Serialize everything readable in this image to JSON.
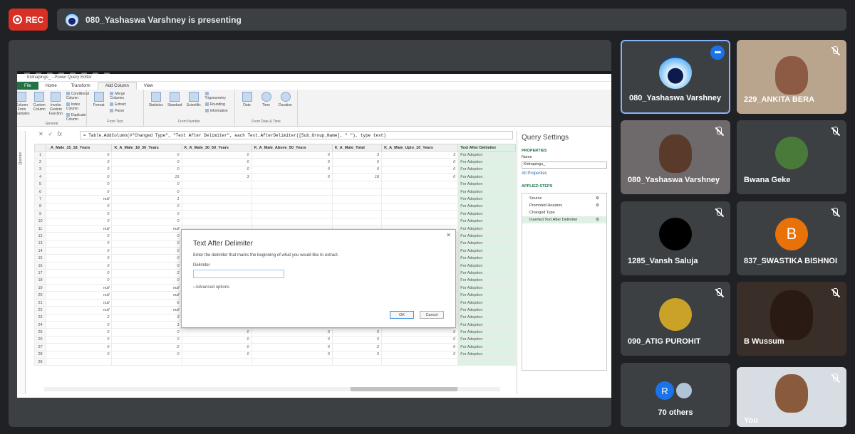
{
  "meet": {
    "rec_label": "REC",
    "presenting_text": "080_Yashaswa Varshney is presenting"
  },
  "app": {
    "window_title": "Kidnapings_ - Power Query Editor",
    "ribbon_tabs": [
      "File",
      "Home",
      "Transform",
      "Add Column",
      "View"
    ],
    "groups": {
      "general": {
        "name": "General",
        "buttons": [
          "Column From Examples",
          "Custom Column",
          "Invoke Custom Function"
        ],
        "list": [
          "Conditional Column",
          "Index Column",
          "Duplicate Column"
        ]
      },
      "from_text": {
        "name": "From Text",
        "buttons": [
          "Format"
        ],
        "list": [
          "Merge Columns",
          "Extract",
          "Parse"
        ]
      },
      "from_number": {
        "name": "From Number",
        "buttons": [
          "Statistics",
          "Standard",
          "Scientific"
        ],
        "list": [
          "Trigonometry",
          "Rounding",
          "Information"
        ]
      },
      "from_date": {
        "name": "From Date & Time",
        "buttons": [
          "Date",
          "Time",
          "Duration"
        ]
      }
    },
    "formula": "= Table.AddColumn(#\"Changed Type\", \"Text After Delimiter\", each Text.AfterDelimiter([Sub_Group_Name], \" \"), type text)",
    "queries_label": "Queries",
    "columns": [
      "_A_Male_15_18_Years",
      "K_A_Male_18_30_Years",
      "K_A_Male_30_50_Years",
      "K_A_Male_Above_50_Years",
      "K_A_Male_Total",
      "K_A_Male_Upto_10_Years",
      "Text After Delimiter"
    ],
    "rows": [
      [
        "0",
        "0",
        "0",
        "0",
        "3",
        "3",
        "For Adoption"
      ],
      [
        "0",
        "0",
        "0",
        "0",
        "0",
        "0",
        "For Adoption"
      ],
      [
        "0",
        "0",
        "0",
        "0",
        "0",
        "0",
        "For Adoption"
      ],
      [
        "0",
        "15",
        "3",
        "0",
        "18",
        "0",
        "For Adoption"
      ],
      [
        "0",
        "0",
        "",
        "",
        "",
        "",
        "For Adoption"
      ],
      [
        "0",
        "0",
        "",
        "",
        "",
        "",
        "For Adoption"
      ],
      [
        "null",
        "1",
        "",
        "",
        "",
        "",
        "For Adoption"
      ],
      [
        "0",
        "0",
        "",
        "",
        "",
        "",
        "For Adoption"
      ],
      [
        "0",
        "0",
        "",
        "",
        "",
        "",
        "For Adoption"
      ],
      [
        "0",
        "0",
        "",
        "",
        "",
        "",
        "For Adoption"
      ],
      [
        "null",
        "null",
        "",
        "",
        "",
        "",
        "For Adoption"
      ],
      [
        "0",
        "0",
        "",
        "",
        "",
        "",
        "For Adoption"
      ],
      [
        "0",
        "0",
        "",
        "",
        "",
        "",
        "For Adoption"
      ],
      [
        "0",
        "0",
        "",
        "",
        "",
        "",
        "For Adoption"
      ],
      [
        "0",
        "0",
        "",
        "",
        "",
        "",
        "For Adoption"
      ],
      [
        "0",
        "0",
        "",
        "",
        "",
        "",
        "For Adoption"
      ],
      [
        "0",
        "2",
        "0",
        "0",
        "2",
        "0",
        "For Adoption"
      ],
      [
        "0",
        "0",
        "0",
        "0",
        "0",
        "0",
        "For Adoption"
      ],
      [
        "null",
        "null",
        "null",
        "null",
        "2",
        "2",
        "For Adoption"
      ],
      [
        "null",
        "null",
        "null",
        "null",
        "1",
        "1",
        "For Adoption"
      ],
      [
        "null",
        "6",
        "1",
        "null",
        "7",
        "0",
        "For Adoption"
      ],
      [
        "null",
        "null",
        "null",
        "null",
        "null",
        "null",
        "For Adoption"
      ],
      [
        "2",
        "3",
        "null",
        "null",
        "5",
        "null",
        "For Adoption"
      ],
      [
        "0",
        "1",
        "0",
        "0",
        "1",
        "0",
        "For Adoption"
      ],
      [
        "0",
        "0",
        "0",
        "0",
        "0",
        "0",
        "For Adoption"
      ],
      [
        "0",
        "0",
        "0",
        "0",
        "0",
        "0",
        "For Adoption"
      ],
      [
        "0",
        "2",
        "0",
        "0",
        "2",
        "0",
        "For Adoption"
      ],
      [
        "0",
        "0",
        "0",
        "0",
        "0",
        "0",
        "For Adoption"
      ],
      [
        "",
        "",
        "",
        "",
        "",
        "",
        ""
      ]
    ],
    "query_settings": {
      "title": "Query Settings",
      "properties_label": "PROPERTIES",
      "name_label": "Name",
      "name_value": "Kidnapings_",
      "all_properties": "All Properties",
      "applied_steps_label": "APPLIED STEPS",
      "steps": [
        "Source",
        "Promoted Headers",
        "Changed Type",
        "Inserted Text After Delimiter"
      ]
    },
    "dialog": {
      "title": "Text After Delimiter",
      "description": "Enter the delimiter that marks the beginning of what you would like to extract.",
      "delimiter_label": "Delimiter",
      "advanced": "Advanced options",
      "ok": "OK",
      "cancel": "Cancel"
    }
  },
  "participants": [
    {
      "name": "080_Yashaswa Varshney",
      "kind": "avatar-logo",
      "muted": false,
      "pinned": true
    },
    {
      "name": "229_ANKITA BERA",
      "kind": "video",
      "muted": true
    },
    {
      "name": "080_Yashaswa Varshney",
      "kind": "video",
      "muted": true
    },
    {
      "name": "Bwana Geke",
      "kind": "photo",
      "muted": true
    },
    {
      "name": "1285_Vansh Saluja",
      "kind": "black-avatar",
      "muted": true
    },
    {
      "name": "837_SWASTIKA BISHNOI",
      "kind": "letter",
      "letter": "B",
      "color": "#e8710a",
      "muted": true
    },
    {
      "name": "090_ATIG PUROHIT",
      "kind": "photo",
      "muted": true
    },
    {
      "name": "B Wussum",
      "kind": "video",
      "muted": true
    },
    {
      "name": "70 others",
      "kind": "others",
      "letter": "R",
      "muted": false
    },
    {
      "name": "You",
      "kind": "video",
      "muted": true
    }
  ]
}
